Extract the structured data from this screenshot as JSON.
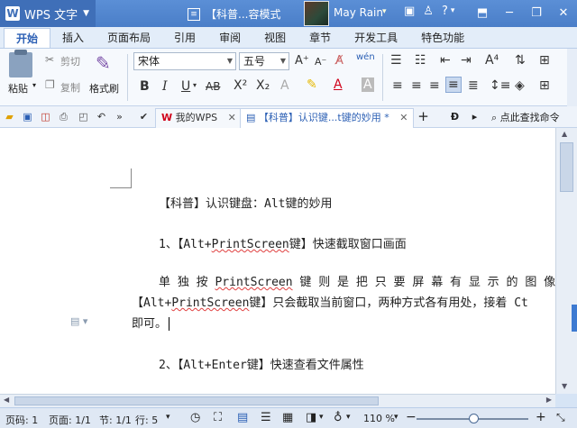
{
  "titlebar": {
    "app_name": "WPS 文字",
    "doc_title": "【科普...容模式",
    "user_name": "May Rain",
    "icons": [
      "skin-icon",
      "shirt-icon",
      "help-icon",
      "minimize-ribbon-icon"
    ],
    "window_controls": [
      "minimize-icon",
      "restore-icon",
      "close-icon"
    ]
  },
  "ribbon_tabs": [
    "开始",
    "插入",
    "页面布局",
    "引用",
    "审阅",
    "视图",
    "章节",
    "开发工具",
    "特色功能"
  ],
  "ribbon": {
    "paste_label": "粘贴",
    "cut_label": "剪切",
    "copy_label": "复制",
    "format_painter_label": "格式刷",
    "font_name": "宋体",
    "font_size": "五号"
  },
  "doc_tabs": {
    "home_tab": "我的WPS",
    "active_tab": "【科普】认识键...t键的妙用 *",
    "find_command": "点此查找命令"
  },
  "document": {
    "title": "【科普】认识键盘：Alt键的妙用",
    "h1_prefix": "1、【Alt+",
    "h1_link": "PrintScreen",
    "h1_suffix": "键】快速截取窗口画面",
    "p1_line1_a": "单 独 按 ",
    "p1_line1_b": "PrintScreen",
    "p1_line1_c": " 键 则 是 把 只 要 屏 幕 有 显 示 的 图 像 都 截",
    "p1_line2_a": "【Alt+",
    "p1_line2_b": "PrintScreen",
    "p1_line2_c": "键】只会截取当前窗口，两种方式各有用处，接着 Ct",
    "p1_line3": "即可。",
    "h2": "2、【Alt+Enter键】快速查看文件属性"
  },
  "statusbar": {
    "page_number": "页码: 1",
    "pages": "页面: 1/1",
    "section": "节: 1/1",
    "row": "行: 5",
    "zoom": "110 %",
    "zoom_level": 110
  }
}
